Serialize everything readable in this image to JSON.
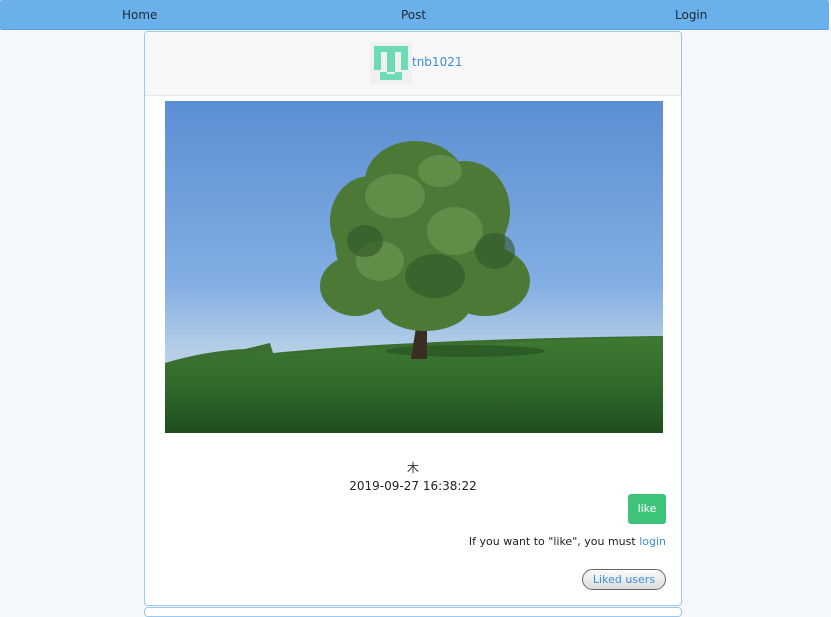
{
  "nav": {
    "home": "Home",
    "post": "Post",
    "login": "Login"
  },
  "post": {
    "username": "tnb1021",
    "caption": "木",
    "timestamp": "2019-09-27 16:38:22",
    "like_label": "like",
    "login_prompt": "If you want to \"like\", you must",
    "login_link": "login",
    "liked_users_label": "Liked users"
  },
  "colors": {
    "navbar": "#6ab0ea",
    "link": "#3a8ed8",
    "like_button": "#3ec47a",
    "avatar_identicon": "#6ddbb6"
  }
}
